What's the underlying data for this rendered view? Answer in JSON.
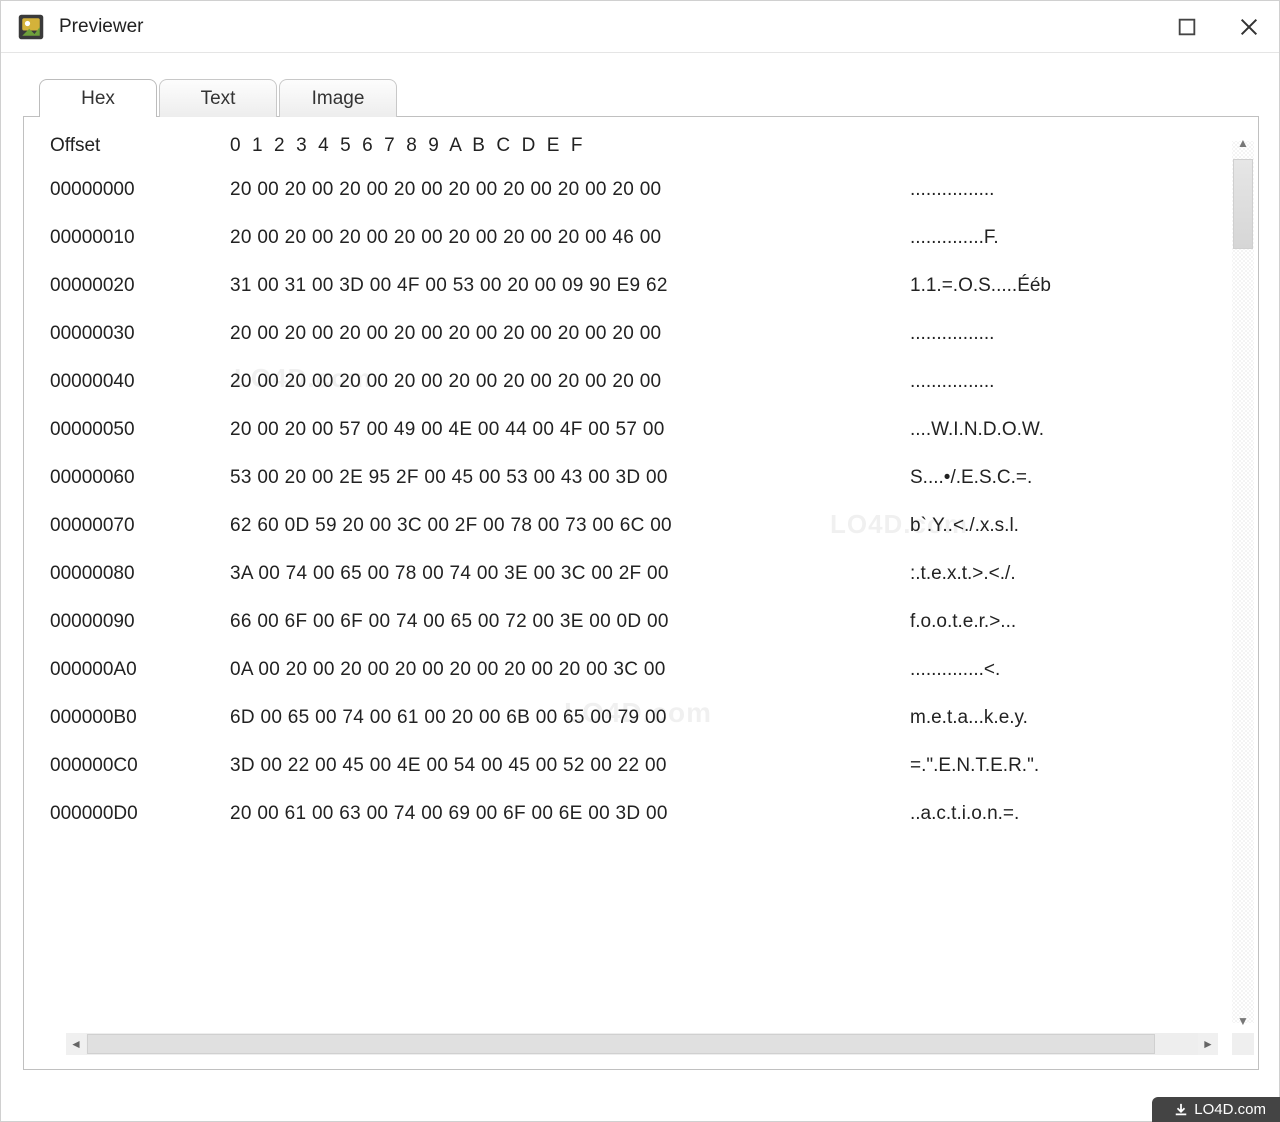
{
  "window": {
    "title": "Previewer"
  },
  "tabs": {
    "hex": "Hex",
    "text": "Text",
    "image": "Image",
    "active": "hex"
  },
  "hex": {
    "offset_label": "Offset",
    "columns_header": "0  1  2  3  4  5  6  7  8  9  A  B  C  D  E  F",
    "rows": [
      {
        "offset": "00000000",
        "bytes": "20 00 20 00 20 00 20 00 20 00 20 00 20 00 20 00",
        "ascii": "................"
      },
      {
        "offset": "00000010",
        "bytes": "20 00 20 00 20 00 20 00 20 00 20 00 20 00 46 00",
        "ascii": "..............F."
      },
      {
        "offset": "00000020",
        "bytes": "31 00 31 00 3D 00 4F 00 53 00 20 00 09 90 E9 62",
        "ascii": "1.1.=.O.S.....Ééb"
      },
      {
        "offset": "00000030",
        "bytes": "20 00 20 00 20 00 20 00 20 00 20 00 20 00 20 00",
        "ascii": "................"
      },
      {
        "offset": "00000040",
        "bytes": "20 00 20 00 20 00 20 00 20 00 20 00 20 00 20 00",
        "ascii": "................"
      },
      {
        "offset": "00000050",
        "bytes": "20 00 20 00 57 00 49 00 4E 00 44 00 4F 00 57 00",
        "ascii": "....W.I.N.D.O.W."
      },
      {
        "offset": "00000060",
        "bytes": "53 00 20 00 2E 95 2F 00 45 00 53 00 43 00 3D 00",
        "ascii": "S....•/.E.S.C.=."
      },
      {
        "offset": "00000070",
        "bytes": "62 60 0D 59 20 00 3C 00 2F 00 78 00 73 00 6C 00",
        "ascii": "b`.Y..<./.x.s.l."
      },
      {
        "offset": "00000080",
        "bytes": "3A 00 74 00 65 00 78 00 74 00 3E 00 3C 00 2F 00",
        "ascii": ":.t.e.x.t.>.<./."
      },
      {
        "offset": "00000090",
        "bytes": "66 00 6F 00 6F 00 74 00 65 00 72 00 3E 00 0D 00",
        "ascii": "f.o.o.t.e.r.>..."
      },
      {
        "offset": "000000A0",
        "bytes": "0A 00 20 00 20 00 20 00 20 00 20 00 20 00 3C 00",
        "ascii": "..............<."
      },
      {
        "offset": "000000B0",
        "bytes": "6D 00 65 00 74 00 61 00 20 00 6B 00 65 00 79 00",
        "ascii": "m.e.t.a...k.e.y."
      },
      {
        "offset": "000000C0",
        "bytes": "3D 00 22 00 45 00 4E 00 54 00 45 00 52 00 22 00",
        "ascii": "=.\".E.N.T.E.R.\"."
      },
      {
        "offset": "000000D0",
        "bytes": "20 00 61 00 63 00 74 00 69 00 6F 00 6E 00 3D 00",
        "ascii": "..a.c.t.i.o.n.=."
      }
    ]
  },
  "watermark_text": "LO4D.com",
  "footer_badge": "LO4D.com"
}
